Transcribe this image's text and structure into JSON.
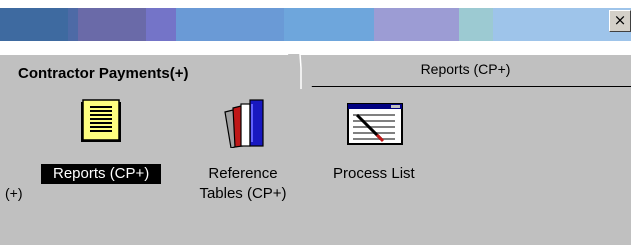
{
  "window": {
    "close_glyph": "×",
    "titlebar_colors": [
      "#3e6aa0",
      "#5c6ea0",
      "#7070b0",
      "#6f7fc8",
      "#6a9ad8",
      "#78a8e0",
      "#6ea4dc",
      "#9e9ad2",
      "#9c9cd4",
      "#9cc8d2",
      "#9ec4e8"
    ]
  },
  "tabs": [
    {
      "label": "Contractor Payments(+)",
      "active": true
    },
    {
      "label": "Reports (CP+)",
      "active": false
    }
  ],
  "items": [
    {
      "label": "Reports (CP+)",
      "icon": "report-document-icon",
      "selected": true
    },
    {
      "label_line1": "Reference",
      "label_line2": "Tables (CP+)",
      "icon": "books-icon",
      "selected": false
    },
    {
      "label": "Process List",
      "icon": "process-list-icon",
      "selected": false
    }
  ],
  "edge_text": "(+)"
}
